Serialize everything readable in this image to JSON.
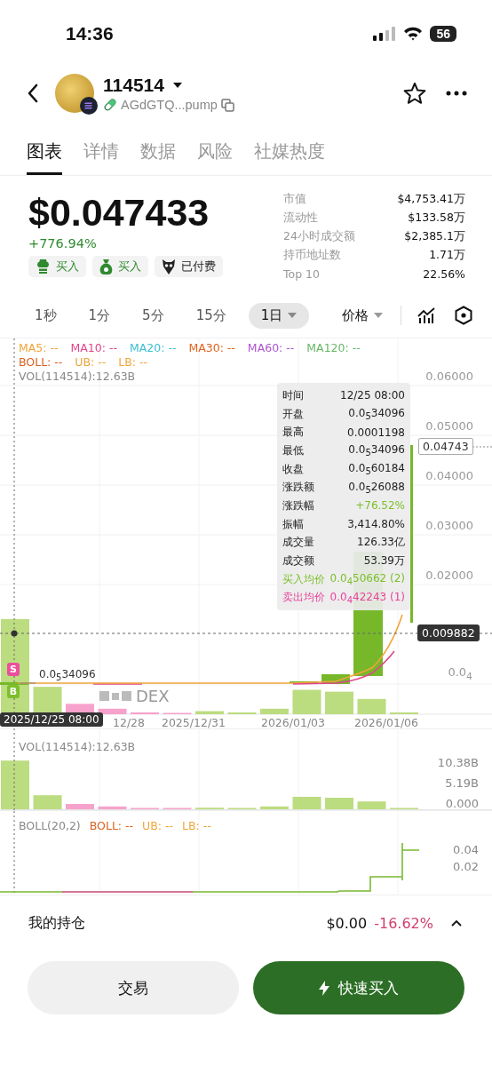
{
  "status_bar": {
    "time": "14:36",
    "battery": "56"
  },
  "header": {
    "name": "114514",
    "address": "AGdGTQ...pump"
  },
  "tabs": [
    {
      "label": "图表",
      "selected": true
    },
    {
      "label": "详情",
      "selected": false
    },
    {
      "label": "数据",
      "selected": false
    },
    {
      "label": "风险",
      "selected": false
    },
    {
      "label": "社媒热度",
      "selected": false
    }
  ],
  "price": {
    "value": "$0.047433",
    "change": "+776.94%"
  },
  "chips": [
    {
      "label": "买入",
      "kind": "chef"
    },
    {
      "label": "买入",
      "kind": "bag"
    },
    {
      "label": "已付费",
      "kind": "bird"
    }
  ],
  "stats": [
    {
      "label": "市值",
      "value": "$4,753.41万"
    },
    {
      "label": "流动性",
      "value": "$133.58万"
    },
    {
      "label": "24小时成交额",
      "value": "$2,385.1万"
    },
    {
      "label": "持币地址数",
      "value": "1.71万"
    },
    {
      "label": "Top 10",
      "value": "22.56%"
    }
  ],
  "intervals": [
    {
      "label": "1秒",
      "selected": false
    },
    {
      "label": "1分",
      "selected": false
    },
    {
      "label": "5分",
      "selected": false
    },
    {
      "label": "15分",
      "selected": false
    },
    {
      "label": "1日",
      "selected": true
    }
  ],
  "price_mode": "价格",
  "chart": {
    "ma_legend": [
      {
        "label": "MA5: --",
        "color": "#f0a43a"
      },
      {
        "label": "MA10: --",
        "color": "#e0468c"
      },
      {
        "label": "MA20: --",
        "color": "#3cc0d0"
      },
      {
        "label": "MA30: --",
        "color": "#e0621e"
      },
      {
        "label": "MA60: --",
        "color": "#b054d0"
      },
      {
        "label": "MA120: --",
        "color": "#66b866"
      }
    ],
    "boll_legend": [
      {
        "label": "BOLL: --",
        "color": "#d9601e"
      },
      {
        "label": "UB: --",
        "color": "#f0a43a"
      },
      {
        "label": "LB: --",
        "color": "#f0a43a"
      }
    ],
    "vol_label": "VOL(114514):12.63B",
    "y_labels": [
      "0.06000",
      "0.05000",
      "0.04000",
      "0.03000",
      "0.02000"
    ],
    "low_axis_label": "0.0$_{4}$",
    "price_tag": "0.04743",
    "cross_tag": "0.009882",
    "date_tag": "2025/12/25 08:00",
    "x_labels": [
      "12/28",
      "2025/12/31",
      "2026/01/03",
      "2026/01/06"
    ],
    "low_label": "0.0$_{5}$34096",
    "markers": [
      {
        "label": "S",
        "kind": "sell"
      },
      {
        "label": "B",
        "kind": "buy"
      }
    ],
    "watermark": "DEX",
    "tooltip": [
      {
        "label": "时间",
        "value": "12/25 08:00",
        "kind": "plain"
      },
      {
        "label": "开盘",
        "value": "0.0$_{5}$34096",
        "kind": "plain"
      },
      {
        "label": "最高",
        "value": "0.0001198",
        "kind": "plain"
      },
      {
        "label": "最低",
        "value": "0.0$_{5}$34096",
        "kind": "plain"
      },
      {
        "label": "收盘",
        "value": "0.0$_{5}$60184",
        "kind": "plain"
      },
      {
        "label": "涨跌额",
        "value": "0.0$_{5}$26088",
        "kind": "plain"
      },
      {
        "label": "涨跌幅",
        "value": "+76.52%",
        "kind": "up"
      },
      {
        "label": "振幅",
        "value": "3,414.80%",
        "kind": "plain"
      },
      {
        "label": "成交量",
        "value": "126.33亿",
        "kind": "plain"
      },
      {
        "label": "成交额",
        "value": "53.39万",
        "kind": "plain"
      },
      {
        "label": "买入均价",
        "value": "0.0$_{4}$50662 (2)",
        "kind": "buy"
      },
      {
        "label": "卖出均价",
        "value": "0.0$_{4}$42243 (1)",
        "kind": "sell"
      }
    ]
  },
  "volume": {
    "label": "VOL(114514):12.63B",
    "y_labels": [
      "10.38B",
      "5.19B",
      "0.000"
    ]
  },
  "boll": {
    "name": "BOLL(20,2)",
    "items": [
      {
        "label": "BOLL: --",
        "color": "#d9601e"
      },
      {
        "label": "UB: --",
        "color": "#f0a43a"
      },
      {
        "label": "LB: --",
        "color": "#f0a43a"
      }
    ],
    "y_labels": [
      "0.04",
      "0.02"
    ]
  },
  "holdings": {
    "label": "我的持仓",
    "value": "$0.00",
    "change": "-16.62%"
  },
  "buttons": [
    {
      "label": "交易",
      "kind": "secondary"
    },
    {
      "label": "快速买入",
      "kind": "primary"
    }
  ]
}
